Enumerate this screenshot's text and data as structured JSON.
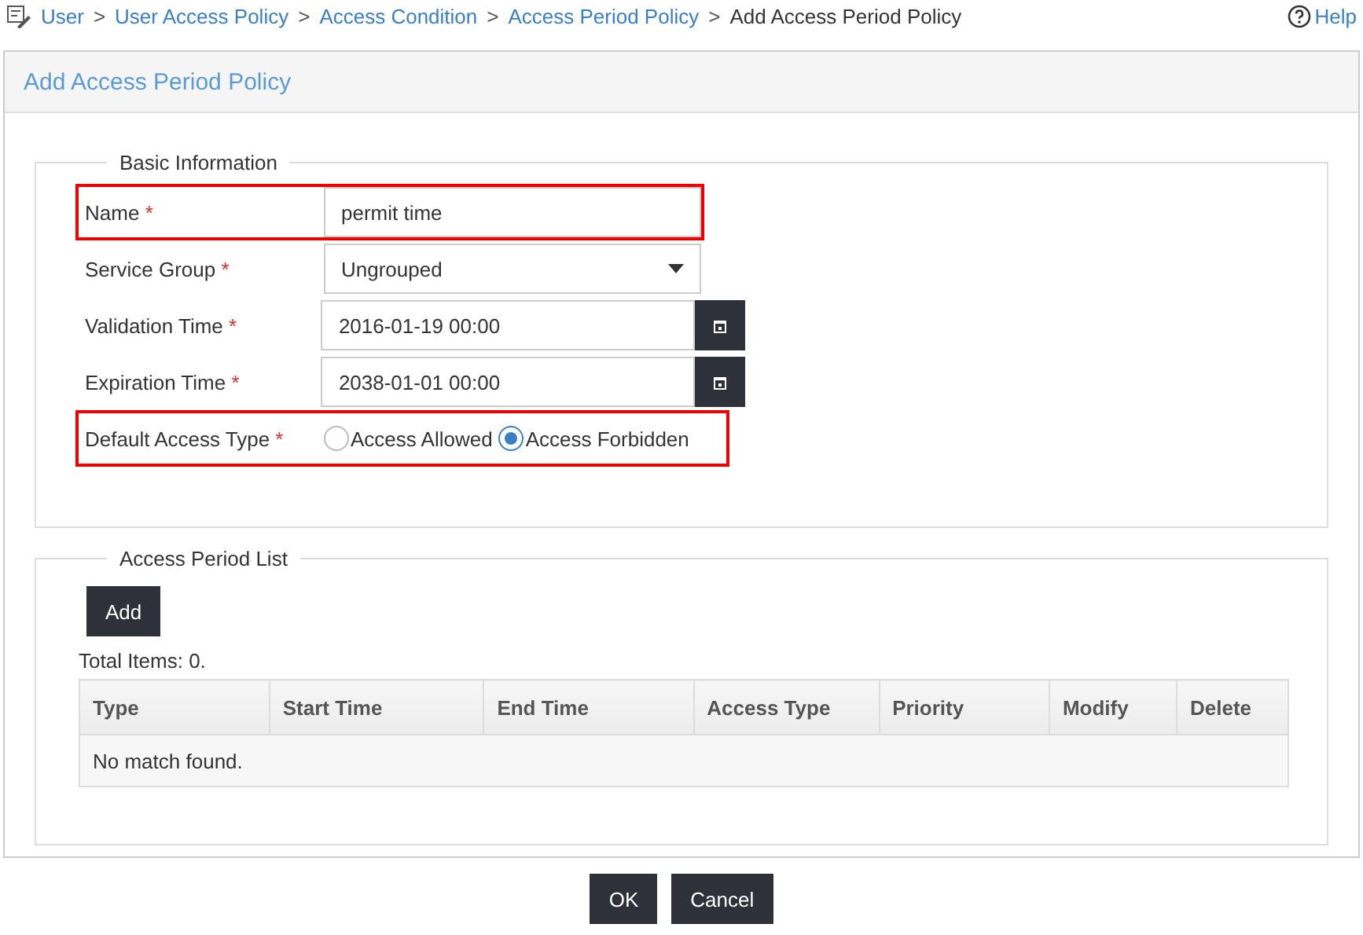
{
  "breadcrumb": {
    "items": [
      {
        "label": "User",
        "link": true
      },
      {
        "label": "User Access Policy",
        "link": true
      },
      {
        "label": "Access Condition",
        "link": true
      },
      {
        "label": "Access Period Policy",
        "link": true
      },
      {
        "label": "Add Access Period Policy",
        "link": false
      }
    ],
    "separator": ">",
    "help": "Help"
  },
  "panel": {
    "title": "Add Access Period Policy"
  },
  "basic_information": {
    "legend": "Basic Information",
    "fields": [
      {
        "kind": "text",
        "label": "Name",
        "required_mark": "*",
        "value": "permit time",
        "highlighted": true
      },
      {
        "kind": "select",
        "label": "Service Group",
        "required_mark": "*",
        "value": "Ungrouped",
        "highlighted": false
      },
      {
        "kind": "date",
        "label": "Validation Time",
        "required_mark": "*",
        "value": "2016-01-19 00:00",
        "highlighted": false
      },
      {
        "kind": "date",
        "label": "Expiration Time",
        "required_mark": "*",
        "value": "2038-01-01 00:00",
        "highlighted": false
      },
      {
        "kind": "radio",
        "label": "Default Access Type",
        "required_mark": "*",
        "highlighted": true,
        "options": [
          {
            "label": "Access Allowed",
            "selected": false
          },
          {
            "label": "Access Forbidden",
            "selected": true
          }
        ]
      }
    ]
  },
  "access_period_list": {
    "legend": "Access Period List",
    "add_button": "Add",
    "total": "Total Items: 0.",
    "columns": [
      "Type",
      "Start Time",
      "End Time",
      "Access Type",
      "Priority",
      "Modify",
      "Delete"
    ],
    "empty_message": "No match found."
  },
  "buttons": [
    "OK",
    "Cancel"
  ]
}
